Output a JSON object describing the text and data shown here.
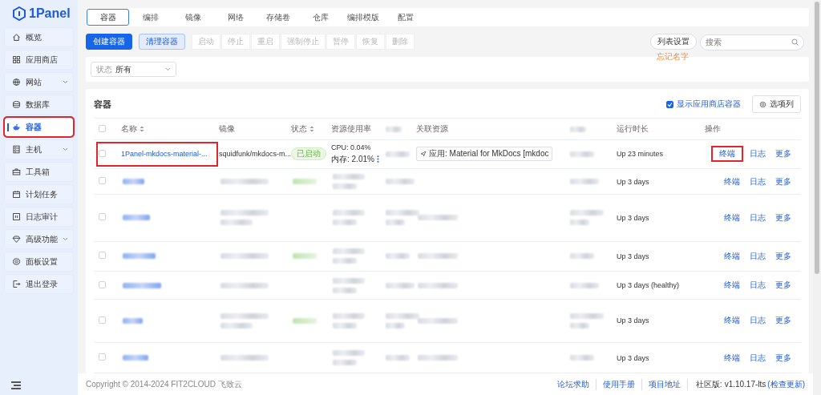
{
  "brand": "1Panel",
  "sidebar": {
    "items": [
      {
        "label": "概览",
        "selected": false,
        "has_submenu": false,
        "annotated": false
      },
      {
        "label": "应用商店",
        "selected": false,
        "has_submenu": false,
        "annotated": false
      },
      {
        "label": "网站",
        "selected": false,
        "has_submenu": true,
        "annotated": false
      },
      {
        "label": "数据库",
        "selected": false,
        "has_submenu": false,
        "annotated": false
      },
      {
        "label": "容器",
        "selected": true,
        "has_submenu": false,
        "annotated": true
      },
      {
        "label": "主机",
        "selected": false,
        "has_submenu": true,
        "annotated": false
      },
      {
        "label": "工具箱",
        "selected": false,
        "has_submenu": false,
        "annotated": false
      },
      {
        "label": "计划任务",
        "selected": false,
        "has_submenu": false,
        "annotated": false
      },
      {
        "label": "日志审计",
        "selected": false,
        "has_submenu": false,
        "annotated": false
      },
      {
        "label": "高级功能",
        "selected": false,
        "has_submenu": true,
        "annotated": false
      },
      {
        "label": "面板设置",
        "selected": false,
        "has_submenu": false,
        "annotated": false
      },
      {
        "label": "退出登录",
        "selected": false,
        "has_submenu": false,
        "annotated": false
      }
    ]
  },
  "tabs": [
    {
      "label": "容器",
      "selected": true
    },
    {
      "label": "编排",
      "selected": false
    },
    {
      "label": "镜像",
      "selected": false
    },
    {
      "label": "网络",
      "selected": false
    },
    {
      "label": "存储卷",
      "selected": false
    },
    {
      "label": "仓库",
      "selected": false
    },
    {
      "label": "编排模版",
      "selected": false
    },
    {
      "label": "配置",
      "selected": false
    }
  ],
  "toolbar": {
    "create_button": "创建容器",
    "clean_button": "清理容器",
    "actions": [
      {
        "label": "启动",
        "disabled": true
      },
      {
        "label": "停止",
        "disabled": true
      },
      {
        "label": "重启",
        "disabled": true
      },
      {
        "label": "强制停止",
        "disabled": true
      },
      {
        "label": "暂停",
        "disabled": true
      },
      {
        "label": "恢复",
        "disabled": true
      },
      {
        "label": "删除",
        "disabled": true
      }
    ],
    "list_settings_button": "列表设置",
    "search": {
      "placeholder": "搜索"
    }
  },
  "annotation": "忘记名字",
  "filter": {
    "label": "状态",
    "value": "所有"
  },
  "table": {
    "title": "容器",
    "select_all_checked": false,
    "show_app_containers": {
      "label": "显示应用商店容器",
      "checked": true
    },
    "columns_button": "选项列",
    "columns": [
      {
        "kind": "text",
        "label": "名称",
        "sortable": true
      },
      {
        "kind": "text",
        "label": "镜像",
        "sortable": false
      },
      {
        "kind": "text",
        "label": "状态",
        "sortable": true
      },
      {
        "kind": "text",
        "label": "资源使用率",
        "sortable": false
      },
      {
        "kind": "redacted"
      },
      {
        "kind": "text",
        "label": "关联资源",
        "sortable": false
      },
      {
        "kind": "redacted"
      },
      {
        "kind": "text",
        "label": "运行时长",
        "sortable": false
      },
      {
        "kind": "text",
        "label": "操作",
        "sortable": false
      }
    ],
    "rows": [
      {
        "redacted": false,
        "checked": false,
        "name_annotated": true,
        "name": "1Panel-mkdocs-material-...",
        "image": "squidfunk/mkdocs-m...",
        "status": {
          "label": "已启动",
          "kind": "running"
        },
        "cpu": "CPU: 0.04%",
        "memory": "内存: 2.01%",
        "linked": "应用: Material for MkDocs [mkdoc",
        "uptime": "Up 23 minutes",
        "actions": [
          {
            "label": "终端",
            "annotated": true
          },
          {
            "label": "日志",
            "annotated": false
          },
          {
            "label": "更多",
            "annotated": false
          }
        ]
      },
      {
        "redacted": true,
        "checked": false,
        "name_annotated": false,
        "uptime": "Up 3 days",
        "actions": [
          {
            "label": "终端",
            "annotated": false
          },
          {
            "label": "日志",
            "annotated": false
          },
          {
            "label": "更多",
            "annotated": false
          }
        ]
      },
      {
        "redacted": true,
        "checked": false,
        "name_annotated": false,
        "uptime": "Up 3 days",
        "actions": [
          {
            "label": "终端",
            "annotated": false
          },
          {
            "label": "日志",
            "annotated": false
          },
          {
            "label": "更多",
            "annotated": false
          }
        ]
      },
      {
        "redacted": true,
        "checked": false,
        "name_annotated": false,
        "uptime": "Up 3 days",
        "actions": [
          {
            "label": "终端",
            "annotated": false
          },
          {
            "label": "日志",
            "annotated": false
          },
          {
            "label": "更多",
            "annotated": false
          }
        ]
      },
      {
        "redacted": true,
        "checked": false,
        "name_annotated": false,
        "uptime": "Up 3 days (healthy)",
        "actions": [
          {
            "label": "终端",
            "annotated": false
          },
          {
            "label": "日志",
            "annotated": false
          },
          {
            "label": "更多",
            "annotated": false
          }
        ]
      },
      {
        "redacted": true,
        "checked": false,
        "name_annotated": false,
        "uptime": "Up 3 days",
        "actions": [
          {
            "label": "终端",
            "annotated": false
          },
          {
            "label": "日志",
            "annotated": false
          },
          {
            "label": "更多",
            "annotated": false
          }
        ]
      },
      {
        "redacted": true,
        "checked": false,
        "name_annotated": false,
        "uptime": "Up 3 days",
        "actions": [
          {
            "label": "终端",
            "annotated": false
          },
          {
            "label": "日志",
            "annotated": false
          },
          {
            "label": "更多",
            "annotated": false
          }
        ]
      }
    ]
  },
  "footer": {
    "copyright": "Copyright © 2014-2024 FIT2CLOUD 飞致云",
    "links": [
      "论坛求助",
      "使用手册",
      "项目地址"
    ],
    "edition": "社区版:",
    "version": "v1.10.17-lts",
    "check_update": "(检查更新)"
  }
}
